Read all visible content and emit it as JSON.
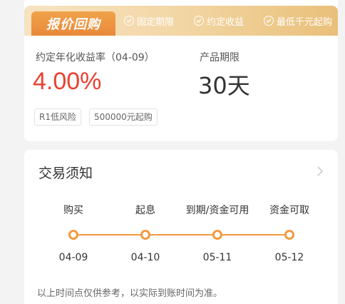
{
  "product": {
    "badge": "报价回购",
    "features": [
      "固定期限",
      "约定收益",
      "最低千元起购"
    ],
    "rate_label": "约定年化收益率（04-09）",
    "rate_value": "4.00%",
    "term_label": "产品期限",
    "term_value": "30天",
    "tags": [
      "R1低风险",
      "500000元起购"
    ]
  },
  "trade": {
    "title": "交易须知",
    "steps": [
      {
        "label": "购买",
        "date": "04-09"
      },
      {
        "label": "起息",
        "date": "04-10"
      },
      {
        "label": "到期/资金可用",
        "date": "05-11"
      },
      {
        "label": "资金可取",
        "date": "05-12"
      }
    ],
    "footnote": "以上时间点仅供参考，以实际到账时间为准。"
  },
  "colors": {
    "accent_orange": "#f39a3f",
    "rate_red": "#e8412f"
  }
}
